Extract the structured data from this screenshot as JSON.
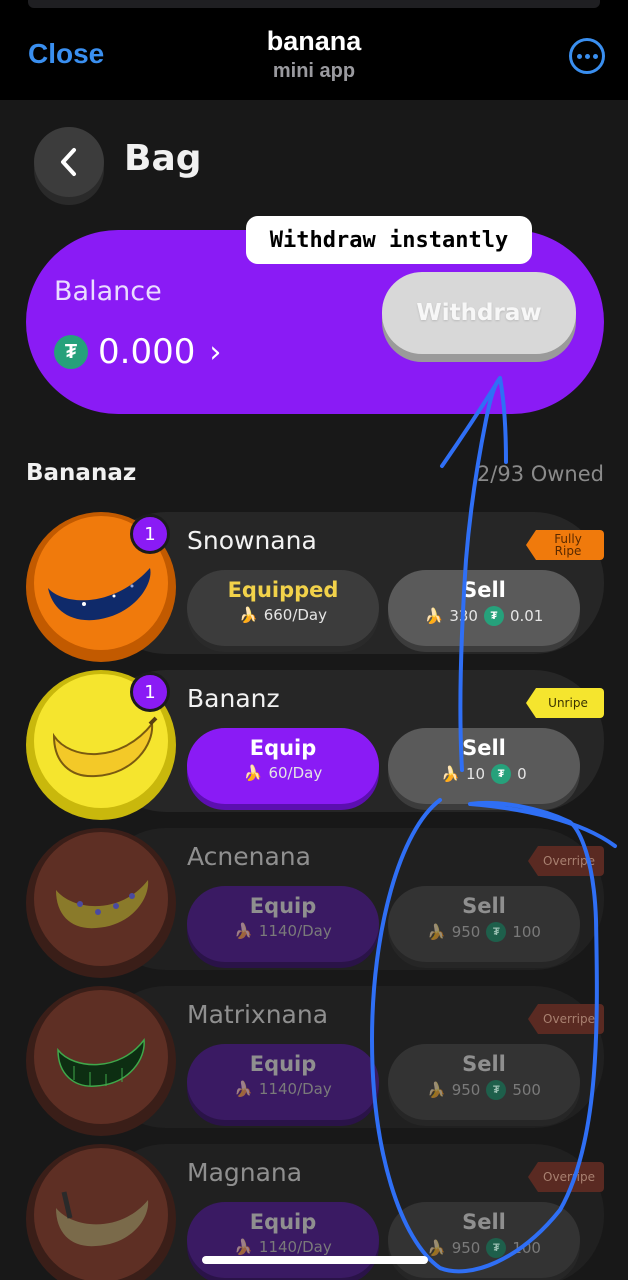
{
  "header": {
    "close_label": "Close",
    "title": "banana",
    "subtitle": "mini app"
  },
  "page": {
    "title": "Bag"
  },
  "balance": {
    "label": "Balance",
    "value": "0.000",
    "withdraw_label": "Withdraw",
    "tooltip": "Withdraw instantly",
    "currency_icon": "tether-icon"
  },
  "section": {
    "title": "Bananaz",
    "owned": "2/93 Owned"
  },
  "items": [
    {
      "name": "Snownana",
      "badge": "1",
      "tag": "Fully Ripe",
      "left_label": "Equipped",
      "left_rate": "660/Day",
      "sell_label": "Sell",
      "sell_banana": "330",
      "sell_usdt": "0.01",
      "colors": {
        "avatar": "#f07a0c",
        "tag_bg": "#f07a0c",
        "left_text": "#f2d24a"
      }
    },
    {
      "name": "Bananz",
      "badge": "1",
      "tag": "Unripe",
      "left_label": "Equip",
      "left_rate": "60/Day",
      "sell_label": "Sell",
      "sell_banana": "10",
      "sell_usdt": "0",
      "colors": {
        "avatar": "#f5e52e",
        "tag_bg": "#f5e52e",
        "left_bg": "#8a1bf5"
      }
    },
    {
      "name": "Acnenana",
      "tag": "Overripe",
      "left_label": "Equip",
      "left_rate": "1140/Day",
      "sell_label": "Sell",
      "sell_banana": "950",
      "sell_usdt": "100"
    },
    {
      "name": "Matrixnana",
      "tag": "Overripe",
      "left_label": "Equip",
      "left_rate": "1140/Day",
      "sell_label": "Sell",
      "sell_banana": "950",
      "sell_usdt": "500"
    },
    {
      "name": "Magnana",
      "tag": "Overripe",
      "left_label": "Equip",
      "left_rate": "1140/Day",
      "sell_label": "Sell",
      "sell_banana": "950",
      "sell_usdt": "100"
    }
  ],
  "colors": {
    "accent_purple": "#8a1bf5",
    "telegram_blue": "#3a8ff0",
    "annotation_blue": "#2f6ff5",
    "tether_green": "#26a17b"
  }
}
